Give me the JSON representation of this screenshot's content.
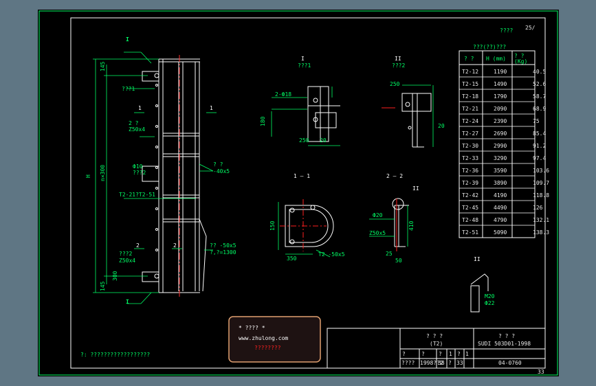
{
  "title_block": {
    "top_right_label": "????",
    "corner_mark": "25/",
    "drawing_name": "? ? ?",
    "drawing_code": "(T2)",
    "standard_title": "? ? ?",
    "standard_no": "SUDI 503D01-1998",
    "sheet_label": "????",
    "row_values": [
      "1998??2",
      "38",
      "?",
      "33"
    ],
    "drawing_no": "04-0760",
    "sheet_no": "33",
    "cell_marks": [
      "?",
      "?",
      "?",
      "1",
      "?",
      "1"
    ]
  },
  "note": "?: ??????????????????",
  "watermark": {
    "line1": "* ???? *",
    "line2": "www.zhulong.com",
    "line3": "????????"
  },
  "table": {
    "title": "???(??)???",
    "headers": [
      "? ?",
      "H (mm)",
      "? ?\n(Kg)"
    ],
    "rows": [
      {
        "type": "T2-12",
        "h": "1190",
        "w": "40.5"
      },
      {
        "type": "T2-15",
        "h": "1490",
        "w": "52.6"
      },
      {
        "type": "T2-18",
        "h": "1790",
        "w": "58.7"
      },
      {
        "type": "T2-21",
        "h": "2090",
        "w": "68.9"
      },
      {
        "type": "T2-24",
        "h": "2390",
        "w": "75"
      },
      {
        "type": "T2-27",
        "h": "2690",
        "w": "85.4"
      },
      {
        "type": "T2-30",
        "h": "2990",
        "w": "91.2"
      },
      {
        "type": "T2-33",
        "h": "3290",
        "w": "97.4"
      },
      {
        "type": "T2-36",
        "h": "3590",
        "w": "103.6"
      },
      {
        "type": "T2-39",
        "h": "3890",
        "w": "109.7"
      },
      {
        "type": "T2-42",
        "h": "4190",
        "w": "118.8"
      },
      {
        "type": "T2-45",
        "h": "4490",
        "w": "126"
      },
      {
        "type": "T2-48",
        "h": "4790",
        "w": "132.1"
      },
      {
        "type": "T2-51",
        "h": "5090",
        "w": "138.3"
      }
    ]
  },
  "views": {
    "detail_I_top": "I",
    "detail_I_sub": "???1",
    "detail_II_top": "II",
    "detail_II_sub": "???2",
    "section_11": "1 — 1",
    "section_22": "2 — 2",
    "detail_II_bottom": "II"
  },
  "labels": {
    "main_I": "I",
    "main_H": "H",
    "main_n300": "n×300",
    "dim_145_top": "145",
    "dim_300": "300",
    "dim_145_bot": "145",
    "label_p1": "???1",
    "label_p1_z": "2 ?\nZ50x4",
    "label_d10": "Ф10\n???2",
    "label_t2": "T2-21?T2-51",
    "label_right": "? ?\n-40x5",
    "label_right2": "?? -50x5\n?,?=1300",
    "label_p2": "???2\nZ50x4",
    "sec11_left": "1",
    "sec11_right": "1",
    "sec22_left": "2",
    "sec22_right": "2",
    "d_250": "250",
    "d_20": "20",
    "d_180": "180",
    "d_250b": "250",
    "d_350": "350",
    "d_150": "150",
    "d_410": "410",
    "d_25": "25",
    "d_50": "50",
    "d_phi20": "Ф20",
    "d_phi22": "Ф22",
    "d_m20": "M20",
    "sec_pl": "T2 -50x5",
    "z50": "Z50x5"
  }
}
